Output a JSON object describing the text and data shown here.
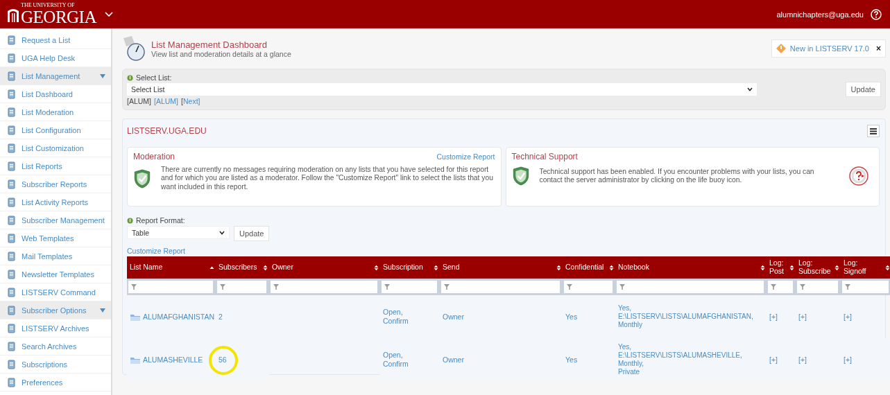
{
  "header": {
    "logo_small": "THE UNIVERSITY OF",
    "logo": "GEORGIA",
    "user": "alumnichapters@uga.edu"
  },
  "sidebar": {
    "items": [
      {
        "label": "Request a List",
        "kind": "link"
      },
      {
        "label": "UGA Help Desk",
        "kind": "link"
      },
      {
        "label": "List Management",
        "kind": "section",
        "expanded": true
      },
      {
        "label": "List Dashboard",
        "kind": "link"
      },
      {
        "label": "List Moderation",
        "kind": "link"
      },
      {
        "label": "List Configuration",
        "kind": "link"
      },
      {
        "label": "List Customization",
        "kind": "link"
      },
      {
        "label": "List Reports",
        "kind": "link"
      },
      {
        "label": "Subscriber Reports",
        "kind": "link"
      },
      {
        "label": "List Activity Reports",
        "kind": "link"
      },
      {
        "label": "Subscriber Management",
        "kind": "link"
      },
      {
        "label": "Web Templates",
        "kind": "link"
      },
      {
        "label": "Mail Templates",
        "kind": "link"
      },
      {
        "label": "Newsletter Templates",
        "kind": "link"
      },
      {
        "label": "LISTSERV Command",
        "kind": "link"
      },
      {
        "label": "Subscriber Options",
        "kind": "section",
        "expanded": true
      },
      {
        "label": "LISTSERV Archives",
        "kind": "link"
      },
      {
        "label": "Search Archives",
        "kind": "link"
      },
      {
        "label": "Subscriptions",
        "kind": "link"
      },
      {
        "label": "Preferences",
        "kind": "link"
      }
    ]
  },
  "page": {
    "title": "List Management Dashboard",
    "subtitle": "View list and moderation details at a glance",
    "news": "New in LISTSERV 17.0",
    "close": "×"
  },
  "select_list": {
    "label": "Select List:",
    "value": "Select List",
    "button": "Update",
    "nav": [
      {
        "text": "[ALUM]",
        "link": false
      },
      {
        "text": "[ALUM]",
        "link": true
      },
      {
        "text": "[",
        "link": false
      },
      {
        "text": "Next]",
        "link": true
      }
    ]
  },
  "server": {
    "title": "LISTSERV.UGA.EDU"
  },
  "cards": [
    {
      "title": "Moderation",
      "link": "Customize Report",
      "text": "There are currently no messages requiring moderation on any lists that you have selected for this report and for which you are listed as a moderator. Follow the \"Customize Report\" link to select the lists that you want included in this report.",
      "kind": "moderation"
    },
    {
      "title": "Technical Support",
      "text": "Technical support has been enabled. If you encounter problems with your lists, you can contact the server administrator by clicking on the life buoy icon.",
      "kind": "support"
    }
  ],
  "report_format": {
    "label": "Report Format:",
    "value": "Table",
    "button": "Update",
    "link": "Customize Report"
  },
  "table": {
    "columns": [
      {
        "label": "List Name",
        "sorted_ascending": true
      },
      {
        "label": "Subscribers",
        "sorted_ascending": false
      },
      {
        "label": "Owner",
        "sorted_ascending": false
      },
      {
        "label": "Subscription",
        "sorted_ascending": false
      },
      {
        "label": "Send",
        "sorted_ascending": false
      },
      {
        "label": "Confidential",
        "sorted_ascending": false
      },
      {
        "label": "Notebook",
        "sorted_ascending": false
      },
      {
        "label": "Log:\nPost",
        "sorted_ascending": false
      },
      {
        "label": "Log:\nSubscribe",
        "sorted_ascending": false
      },
      {
        "label": "Log:\nSignoff",
        "sorted_ascending": false
      }
    ],
    "rows": [
      {
        "list_name": "ALUMAFGHANISTAN",
        "subscribers": "2",
        "subscription": "Open,\nConfirm",
        "send": "Owner",
        "confidential": "Yes",
        "notebook": "Yes,\nE:\\LISTSERV\\LISTS\\ALUMAFGHANISTAN,\nMonthly",
        "log_post": "[+]",
        "log_subscribe": "[+]",
        "log_signoff": "[+]",
        "highlighted": false
      },
      {
        "list_name": "ALUMASHEVILLE",
        "subscribers": "56",
        "subscription": "Open,\nConfirm",
        "send": "Owner",
        "confidential": "Yes",
        "notebook": "Yes,\nE:\\LISTSERV\\LISTS\\ALUMASHEVILLE,\nMonthly,\nPrivate",
        "log_post": "[+]",
        "log_subscribe": "[+]",
        "log_signoff": "[+]",
        "highlighted": true
      }
    ]
  }
}
